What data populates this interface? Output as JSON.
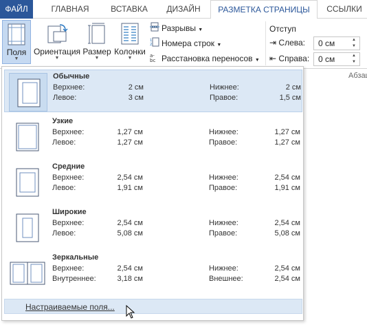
{
  "tabs": [
    {
      "label": "ФАЙЛ"
    },
    {
      "label": "ГЛАВНАЯ"
    },
    {
      "label": "ВСТАВКА"
    },
    {
      "label": "ДИЗАЙН"
    },
    {
      "label": "РАЗМЕТКА СТРАНИЦЫ"
    },
    {
      "label": "ССЫЛКИ"
    }
  ],
  "active_tab": "РАЗМЕТКА СТРАНИЦЫ",
  "ribbon": {
    "margins_label": "Поля",
    "orientation_label": "Ориентация",
    "size_label": "Размер",
    "columns_label": "Колонки",
    "breaks_label": "Разрывы",
    "line_numbers_label": "Номера строк",
    "hyphenation_label": "Расстановка переносов",
    "indent": {
      "title": "Отступ",
      "left_label": "Слева:",
      "left_value": "0 см",
      "right_label": "Справа:",
      "right_value": "0 см"
    },
    "paragraph_group": "Абзац"
  },
  "margin_presets": [
    {
      "name": "Обычные",
      "top_label": "Верхнее:",
      "top": "2 см",
      "bottom_label": "Нижнее:",
      "bottom": "2 см",
      "left_label": "Левое:",
      "left": "3 см",
      "right_label": "Правое:",
      "right": "1,5 см"
    },
    {
      "name": "Узкие",
      "top_label": "Верхнее:",
      "top": "1,27 см",
      "bottom_label": "Нижнее:",
      "bottom": "1,27 см",
      "left_label": "Левое:",
      "left": "1,27 см",
      "right_label": "Правое:",
      "right": "1,27 см"
    },
    {
      "name": "Средние",
      "top_label": "Верхнее:",
      "top": "2,54 см",
      "bottom_label": "Нижнее:",
      "bottom": "2,54 см",
      "left_label": "Левое:",
      "left": "1,91 см",
      "right_label": "Правое:",
      "right": "1,91 см"
    },
    {
      "name": "Широкие",
      "top_label": "Верхнее:",
      "top": "2,54 см",
      "bottom_label": "Нижнее:",
      "bottom": "2,54 см",
      "left_label": "Левое:",
      "left": "5,08 см",
      "right_label": "Правое:",
      "right": "5,08 см"
    },
    {
      "name": "Зеркальные",
      "top_label": "Верхнее:",
      "top": "2,54 см",
      "bottom_label": "Нижнее:",
      "bottom": "2,54 см",
      "left_label": "Внутреннее:",
      "left": "3,18 см",
      "right_label": "Внешнее:",
      "right": "2,54 см"
    }
  ],
  "custom_margins_label": "Настраиваемые поля...",
  "colors": {
    "file_tab": "#2b579a",
    "selection": "#dce8f5",
    "accent_text": "#2b579a"
  },
  "icons": [
    "margins-icon",
    "orientation-icon",
    "size-icon",
    "columns-icon",
    "breaks-icon",
    "line-numbers-icon",
    "hyphenation-icon",
    "indent-left-icon",
    "indent-right-icon",
    "mouse-cursor-icon"
  ]
}
